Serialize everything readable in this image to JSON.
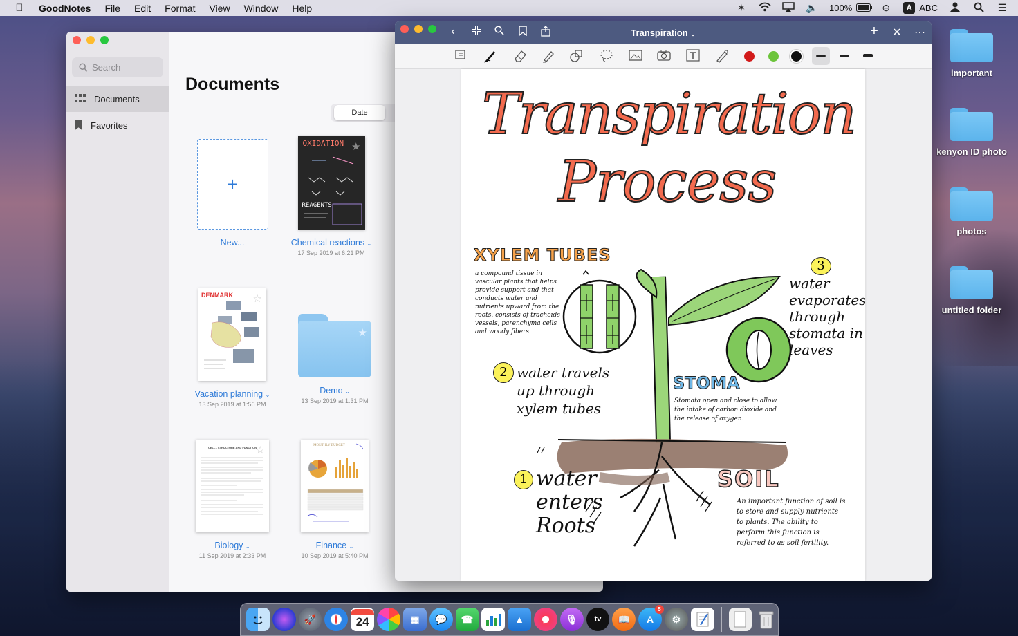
{
  "menubar": {
    "app": "GoodNotes",
    "items": [
      "File",
      "Edit",
      "Format",
      "View",
      "Window",
      "Help"
    ],
    "battery": "100%",
    "input_source": "ABC",
    "input_letter": "A"
  },
  "desktop": {
    "items": [
      {
        "label": "important"
      },
      {
        "label": "kenyon ID photo"
      },
      {
        "label": "photos"
      },
      {
        "label": "untitled folder"
      }
    ]
  },
  "library": {
    "search_placeholder": "Search",
    "sidebar": [
      {
        "label": "Documents",
        "icon": "grid-icon"
      },
      {
        "label": "Favorites",
        "icon": "bookmark-icon"
      }
    ],
    "title": "Documents",
    "sort_label": "Date",
    "documents": [
      {
        "name": "New...",
        "date": ""
      },
      {
        "name": "Chemical reactions",
        "date": "17 Sep 2019 at 6:21 PM"
      },
      {
        "name": "Vacation planning",
        "date": "13 Sep 2019 at 1:56 PM"
      },
      {
        "name": "Demo",
        "date": "13 Sep 2019 at 1:31 PM"
      },
      {
        "name": "Biology",
        "date": "11 Sep 2019 at 2:33 PM"
      },
      {
        "name": "Finance",
        "date": "10 Sep 2019 at 5:40 PM"
      }
    ],
    "thumb_text": {
      "oxidation": "OXIDATION",
      "reagents": "REAGENTS",
      "denmark": "DENMARK",
      "biology_heading": "CELL - STRUCTURE AND FUNCTION",
      "finance_heading": "MONTHLY BUDGET"
    }
  },
  "editor": {
    "title": "Transpiration",
    "colors": {
      "red": "#d21a1a",
      "green": "#6cc43b",
      "black": "#111111"
    },
    "note": {
      "title_line1": "Transpiration",
      "title_line2": "Process",
      "xylem_heading": "XYLEM TUBES",
      "xylem_text": "a compound tissue in vascular plants that helps provide support and that conducts water and nutrients upward from the roots. consists of tracheids vessels, parenchyma cells and woody fibers",
      "step2_num": "2",
      "step2_text": "water travels up through xylem tubes",
      "step3_num": "3",
      "step3_text": "water evaporates through stomata in leaves",
      "stoma_heading": "STOMA",
      "stoma_text": "Stomata open and close to allow the intake of carbon dioxide and the release of oxygen.",
      "step1_num": "1",
      "step1_text": "water enters Roots",
      "soil_heading": "SOIL",
      "soil_text": "An important function of soil is to store and supply nutrients to plants. The ability to perform this function is referred to as soil fertility."
    }
  },
  "dock": {
    "calendar_day": "24",
    "appstore_badge": "5",
    "tv_label": "tv"
  }
}
